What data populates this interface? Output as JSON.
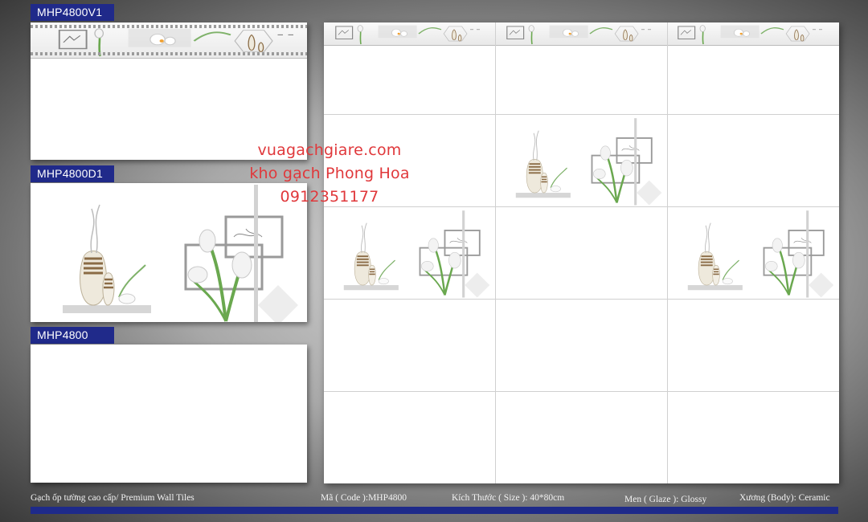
{
  "labels": {
    "v1": "MHP4800V1",
    "d1": "MHP4800D1",
    "plain": "MHP4800"
  },
  "watermark": {
    "line1": "vuagachgiare.com",
    "line2": "kho gạch Phong Hoa",
    "line3": "0912351177"
  },
  "footer": {
    "title": "Gạch ốp tường cao cấp/ Premium Wall Tiles",
    "code": "Mã ( Code ):MHP4800",
    "size": "Kích Thước ( Size ): 40*80cm",
    "glaze": "Men ( Glaze ): Glossy",
    "body": "Xương (Body): Ceramic"
  },
  "colors": {
    "label_bg": "#202a8a",
    "watermark": "#e0383b",
    "footer_bar": "#1e2a8a"
  }
}
